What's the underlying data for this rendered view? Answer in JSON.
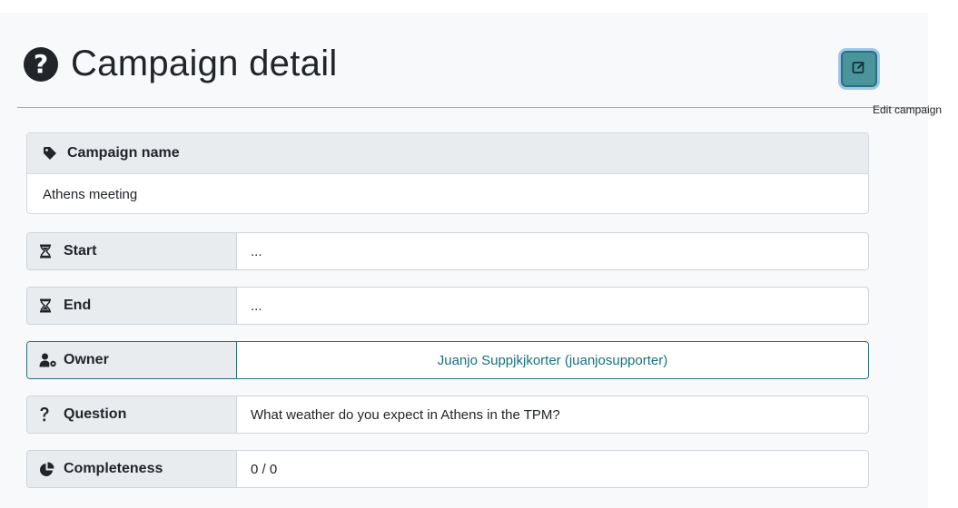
{
  "page": {
    "title": "Campaign detail",
    "title_icon": "question-circle-icon"
  },
  "toolbar": {
    "edit_icon": "edit-icon",
    "edit_tooltip": "Edit campaign"
  },
  "campaign_name": {
    "label": "Campaign name",
    "icon": "tag-icon",
    "value": "Athens meeting"
  },
  "fields": {
    "start": {
      "label": "Start",
      "icon": "hourglass-start-icon",
      "value": "..."
    },
    "end": {
      "label": "End",
      "icon": "hourglass-end-icon",
      "value": "..."
    },
    "owner": {
      "label": "Owner",
      "icon": "user-cog-icon",
      "value": "Juanjo Suppjkjkorter (juanjosupporter)"
    },
    "question": {
      "label": "Question",
      "icon": "question-icon",
      "value": "What weather do you expect in Athens in the TPM?"
    },
    "completeness": {
      "label": "Completeness",
      "icon": "chart-pie-icon",
      "value": "0 / 0"
    }
  },
  "colors": {
    "accent": "#4a959c",
    "owner_link": "#16707c",
    "header_bg": "#e9ecef"
  }
}
